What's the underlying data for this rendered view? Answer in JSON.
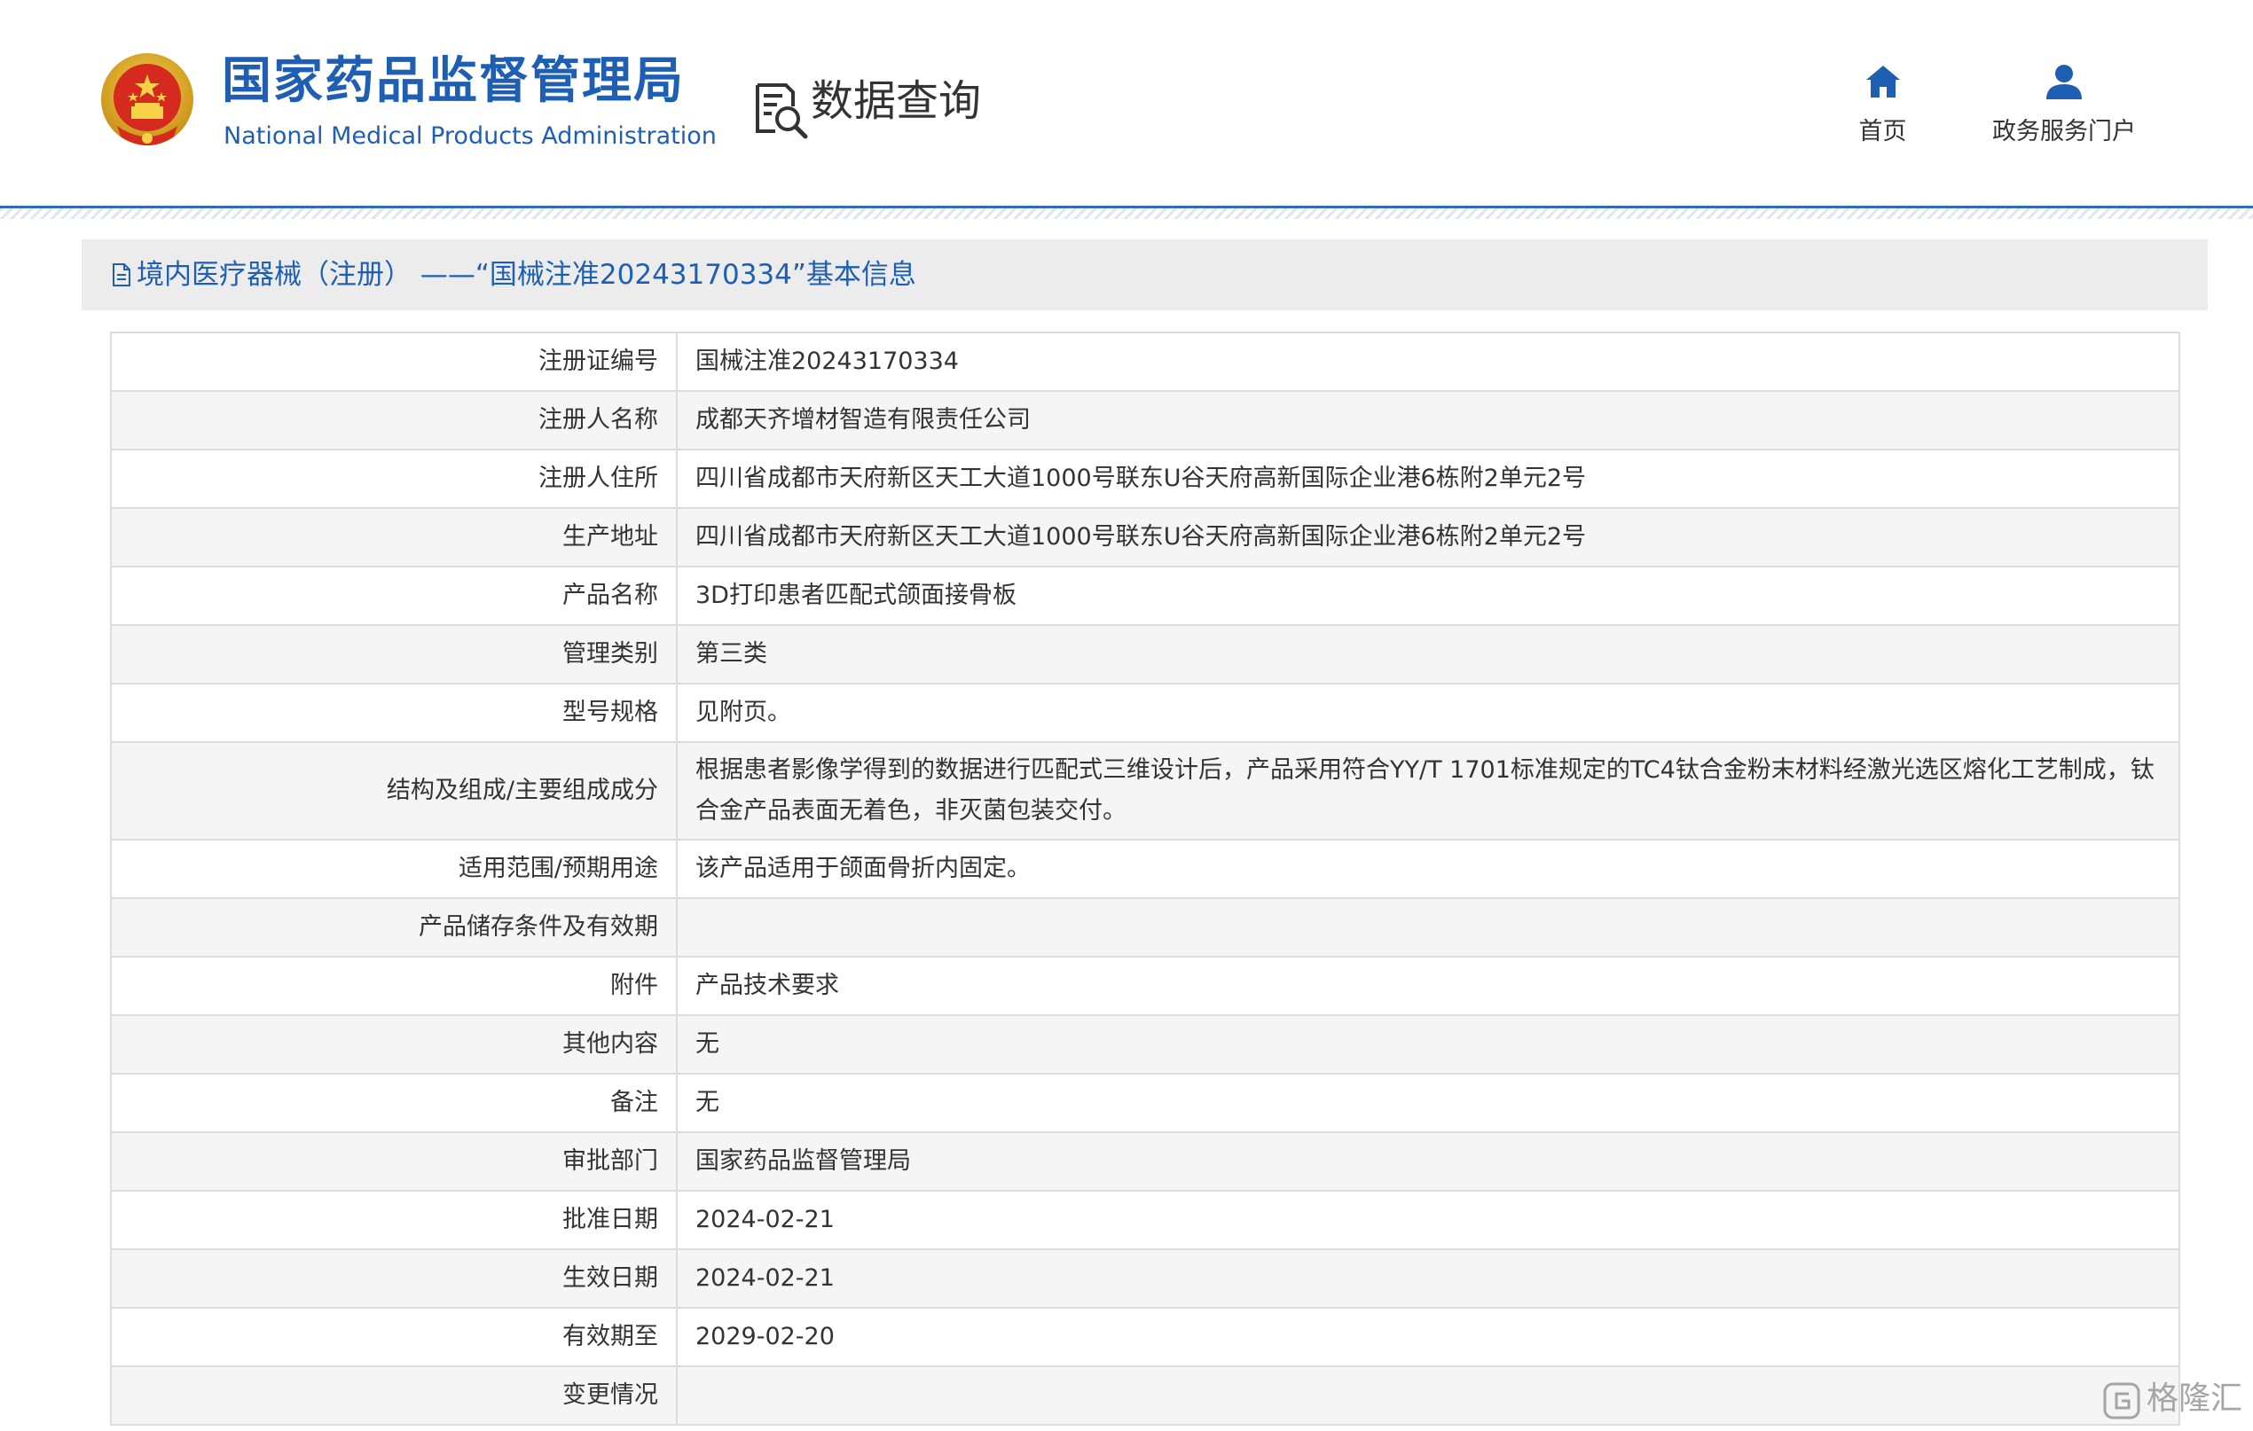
{
  "header": {
    "brand_cn": "国家药品监督管理局",
    "brand_en": "National Medical Products Administration",
    "section_title": "数据查询",
    "nav": [
      {
        "label": "首页",
        "icon": "home-icon"
      },
      {
        "label": "政务服务门户",
        "icon": "user-icon"
      }
    ]
  },
  "panel": {
    "title": "境内医疗器械（注册） ——“国械注准20243170334”基本信息",
    "title_icon": "document-icon"
  },
  "rows": [
    {
      "label": "注册证编号",
      "value": "国械注准20243170334"
    },
    {
      "label": "注册人名称",
      "value": "成都天齐增材智造有限责任公司"
    },
    {
      "label": "注册人住所",
      "value": "四川省成都市天府新区天工大道1000号联东U谷天府高新国际企业港6栋附2单元2号"
    },
    {
      "label": "生产地址",
      "value": "四川省成都市天府新区天工大道1000号联东U谷天府高新国际企业港6栋附2单元2号"
    },
    {
      "label": "产品名称",
      "value": "3D打印患者匹配式颌面接骨板"
    },
    {
      "label": "管理类别",
      "value": "第三类"
    },
    {
      "label": "型号规格",
      "value": "见附页。"
    },
    {
      "label": "结构及组成/主要组成成分",
      "value": "根据患者影像学得到的数据进行匹配式三维设计后，产品采用符合YY/T 1701标准规定的TC4钛合金粉末材料经激光选区熔化工艺制成，钛合金产品表面无着色，非灭菌包装交付。"
    },
    {
      "label": "适用范围/预期用途",
      "value": "该产品适用于颌面骨折内固定。"
    },
    {
      "label": "产品储存条件及有效期",
      "value": ""
    },
    {
      "label": "附件",
      "value": "产品技术要求"
    },
    {
      "label": "其他内容",
      "value": "无"
    },
    {
      "label": "备注",
      "value": "无"
    },
    {
      "label": "审批部门",
      "value": "国家药品监督管理局"
    },
    {
      "label": "批准日期",
      "value": "2024-02-21"
    },
    {
      "label": "生效日期",
      "value": "2024-02-21"
    },
    {
      "label": "有效期至",
      "value": "2029-02-20"
    },
    {
      "label": "变更情况",
      "value": ""
    }
  ],
  "watermark": {
    "text": "格隆汇",
    "icon": "gelonghui-logo-icon"
  },
  "colors": {
    "brand_blue": "#1e5fb3",
    "title_bar": "#ececec",
    "row_alt": "#f5f5f5",
    "border": "#dcdcdc"
  }
}
